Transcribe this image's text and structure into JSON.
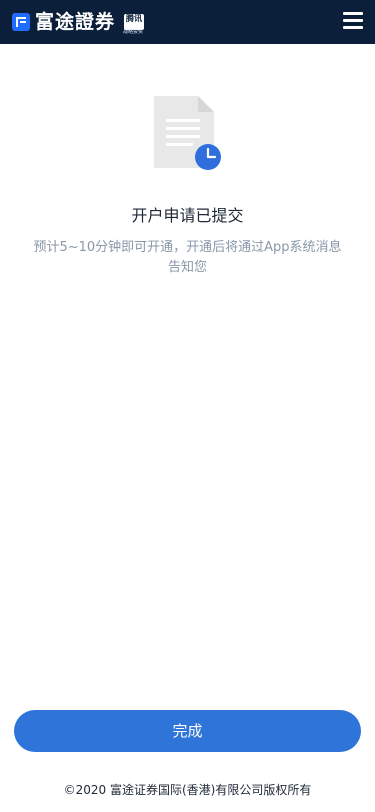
{
  "header": {
    "brand_title": "富途證券",
    "badge_text": "腾讯",
    "badge_subtext": "战略投资",
    "logo_icon": "futu-logo-icon",
    "menu_icon": "hamburger-menu-icon",
    "background_color": "#0b1f3a"
  },
  "status": {
    "illustration_icon": "document-pending-icon",
    "title": "开户申请已提交",
    "description": "预计5~10分钟即可开通，开通后将通过App系统消息告知您"
  },
  "actions": {
    "done_label": "完成",
    "button_color": "#2f74d8"
  },
  "footer": {
    "copyright": "©2020 富途证券国际(香港)有限公司版权所有"
  }
}
